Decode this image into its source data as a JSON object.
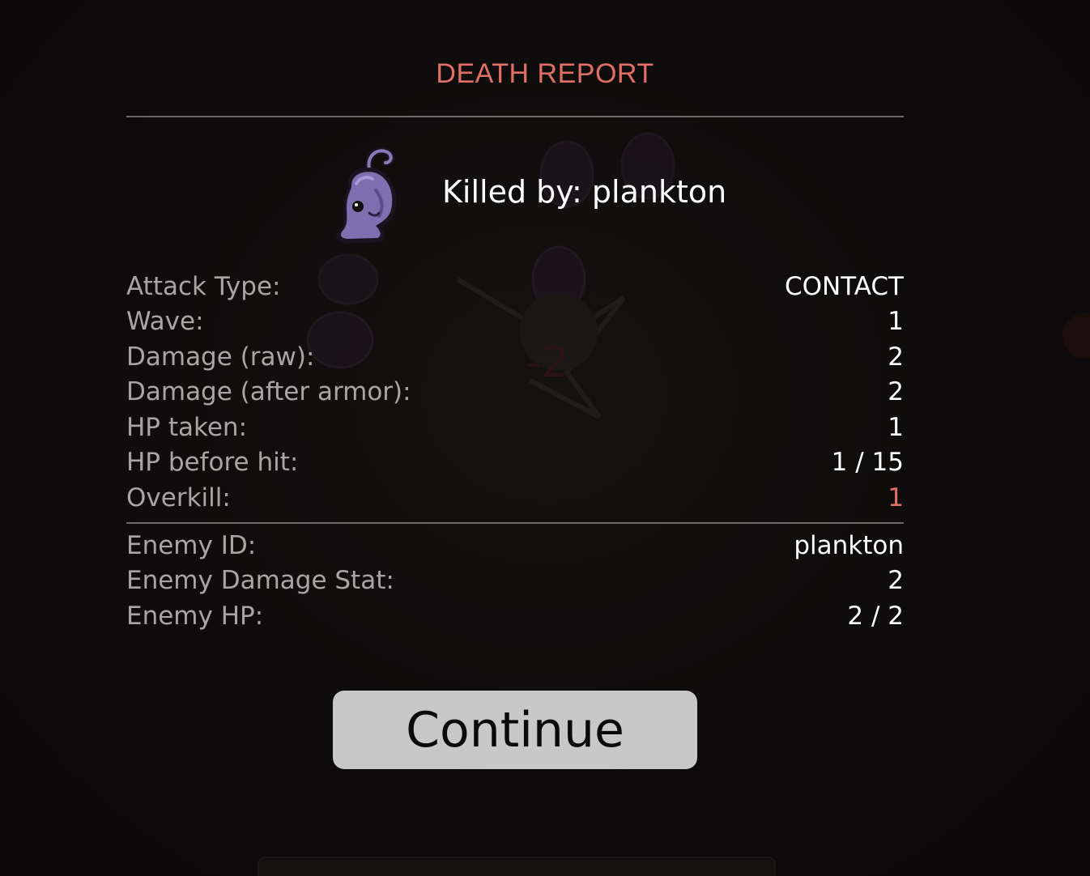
{
  "title": "DEATH REPORT",
  "killed_by": "Killed by: plankton",
  "enemy_icon": "plankton-enemy-icon",
  "combat_stats": [
    {
      "label": "Attack Type:",
      "value": "CONTACT"
    },
    {
      "label": "Wave:",
      "value": "1"
    },
    {
      "label": "Damage (raw):",
      "value": "2"
    },
    {
      "label": "Damage (after armor):",
      "value": "2"
    },
    {
      "label": "HP taken:",
      "value": "1"
    },
    {
      "label": "HP before hit:",
      "value": "1 / 15"
    },
    {
      "label": "Overkill:",
      "value": "1"
    }
  ],
  "enemy_stats": [
    {
      "label": "Enemy ID:",
      "value": "plankton"
    },
    {
      "label": "Enemy Damage Stat:",
      "value": "2"
    },
    {
      "label": "Enemy HP:",
      "value": "2 / 2"
    }
  ],
  "continue_label": "Continue",
  "colors": {
    "accent": "#e06f66",
    "label": "#aaa5a5",
    "value": "#ffffff",
    "button_bg": "#c8c8c8",
    "background": "#0c0a0a"
  }
}
